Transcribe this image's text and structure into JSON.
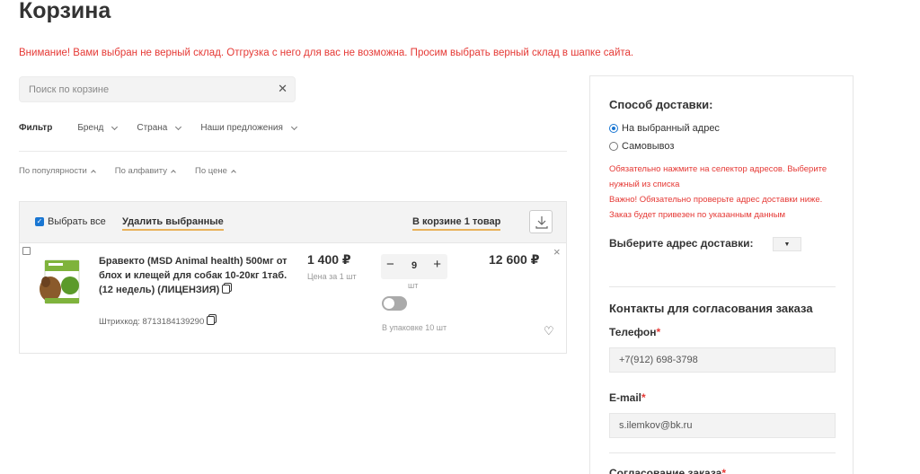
{
  "page": {
    "title": "Корзина",
    "warning": "Внимание! Вами выбран не верный склад. Отгрузка с него для вас не возможна. Просим выбрать верный склад в шапке сайта."
  },
  "search": {
    "placeholder": "Поиск по корзине",
    "clear_icon": "✕"
  },
  "filter": {
    "label": "Фильтр",
    "items": [
      "Бренд",
      "Страна",
      "Наши предложения"
    ]
  },
  "sort": {
    "items": [
      "По популярности",
      "По алфавиту",
      "По цене"
    ]
  },
  "cart_header": {
    "select_all": "Выбрать все",
    "delete_selected": "Удалить выбранные",
    "in_cart": "В корзине 1 товар",
    "download_icon": "download-icon"
  },
  "items": [
    {
      "name": "Бравекто (MSD Animal health) 500мг от блох и клещей для собак 10-20кг 1таб. (12 недель) (ЛИЦЕНЗИЯ)",
      "barcode": "Штрихкод: 8713184139290",
      "price": "1 400 ₽",
      "price_note": "Цена за 1 шт",
      "qty": "9",
      "unit": "шт",
      "pack": "В упаковке 10 шт",
      "total": "12 600 ₽",
      "minus": "−",
      "plus": "+",
      "remove": "×",
      "heart": "♡"
    }
  ],
  "delivery": {
    "title": "Способ доставки:",
    "options": [
      "На выбранный адрес",
      "Самовывоз"
    ],
    "selected": 0,
    "note1": "Обязательно нажмите на селектор адресов. Выберите нужный из списка",
    "note2": "Важно! Обязательно проверьте адрес доставки ниже. Заказ будет привезен по указанным данным",
    "address_label": "Выберите адрес доставки:",
    "address_dropdown": "▼"
  },
  "contacts": {
    "title": "Контакты для согласования заказа",
    "phone_label": "Телефон",
    "phone_value": "+7(912) 698-3798",
    "email_label": "E-mail",
    "email_value": "s.ilemkov@bk.ru",
    "approval_label": "Согласование заказа",
    "required_mark": "*"
  },
  "colors": {
    "warning": "#e53935",
    "accent": "#e8b25b",
    "radio": "#1976d2"
  }
}
